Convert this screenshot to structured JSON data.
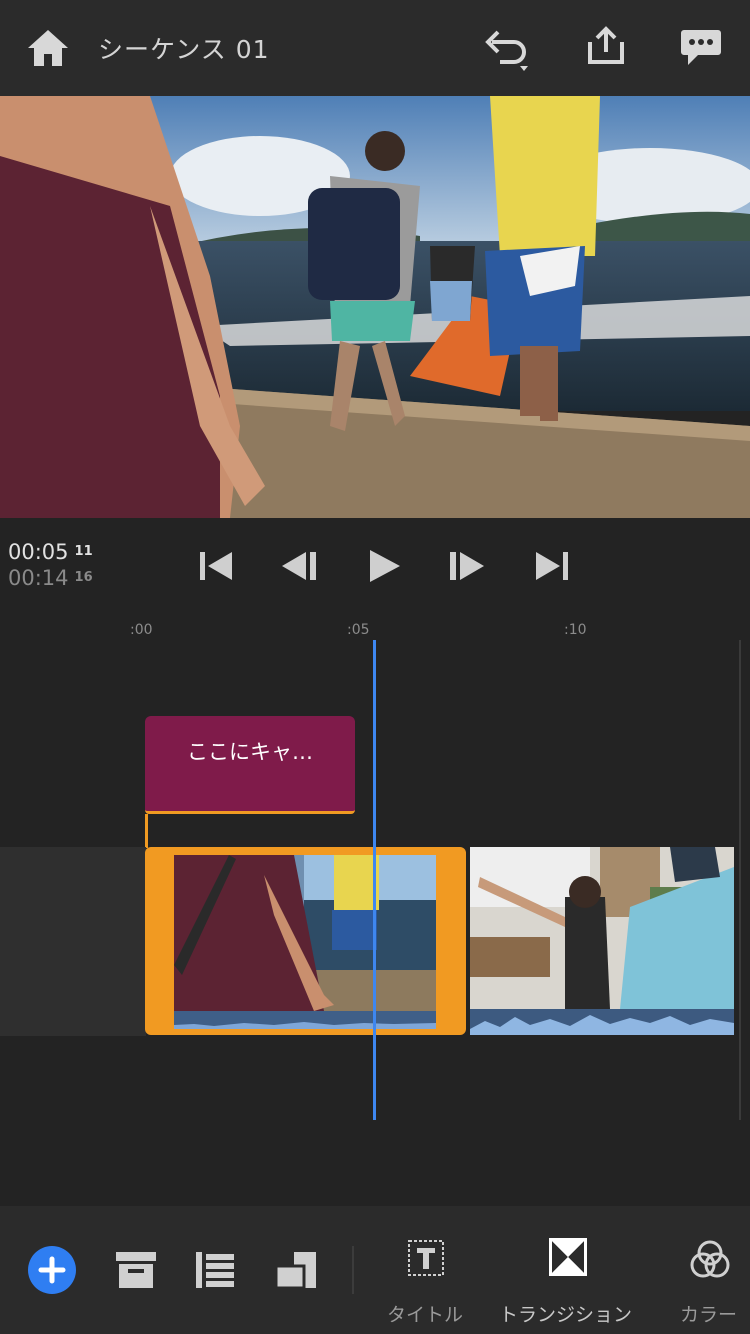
{
  "header": {
    "title": "シーケンス 01",
    "icons": [
      "home-icon",
      "undo-icon",
      "share-icon",
      "feedback-icon"
    ]
  },
  "transport": {
    "current_time": "00:05",
    "current_frames": "11",
    "duration_time": "00:14",
    "duration_frames": "16",
    "controls": [
      "skip-to-start-icon",
      "step-back-icon",
      "play-icon",
      "step-forward-icon",
      "skip-to-end-icon"
    ]
  },
  "timeline": {
    "ruler": [
      ":00",
      ":05",
      ":10"
    ],
    "caption_clip_text": "ここにキャ…",
    "colors": {
      "playhead": "#3e87f0",
      "selected_clip": "#f19a22",
      "caption_clip": "#7f1b4a"
    }
  },
  "toolbar": {
    "add_icon": "plus-icon",
    "tools": [
      {
        "icon": "title-icon",
        "label": "タイトル"
      },
      {
        "icon": "transition-icon",
        "label": "トランジション"
      },
      {
        "icon": "color-icon",
        "label": "カラー"
      }
    ],
    "accent": "#2f7ef2"
  }
}
